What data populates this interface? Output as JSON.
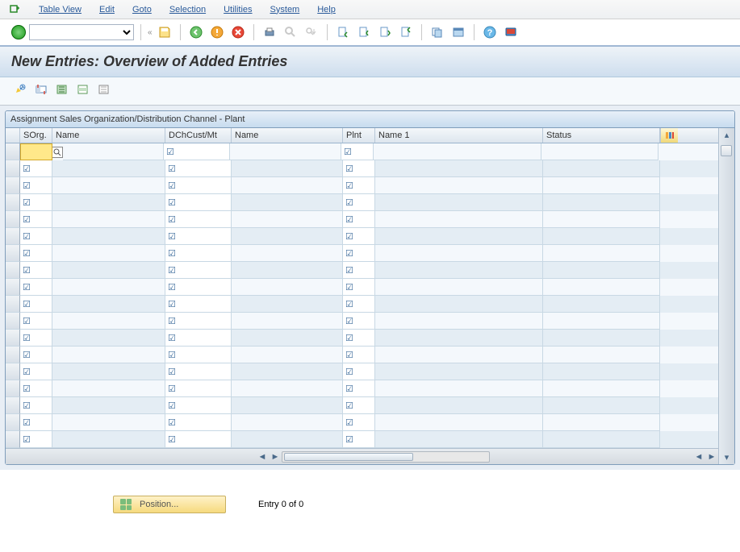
{
  "menu": {
    "items": [
      "Table View",
      "Edit",
      "Goto",
      "Selection",
      "Utilities",
      "System",
      "Help"
    ]
  },
  "toolbar_main": {
    "ok_code": "",
    "icons": [
      "back",
      "save",
      "exec-green",
      "exec-orange",
      "cancel",
      "print",
      "find",
      "find-next",
      "first-page",
      "prev-page",
      "next-page",
      "last-page",
      "new-session",
      "layout",
      "help",
      "gui-options"
    ]
  },
  "page_title": "New Entries: Overview of Added Entries",
  "toolbar_app": {
    "icons": [
      "change",
      "delimit",
      "select-all",
      "deselect-all",
      "config-col"
    ]
  },
  "panel": {
    "title": "Assignment Sales Organization/Distribution Channel - Plant",
    "columns": {
      "sorg": "SOrg.",
      "name": "Name",
      "dch": "DChCust/Mt",
      "name2": "Name",
      "plnt": "Plnt",
      "name1": "Name 1",
      "status": "Status"
    },
    "row_count": 18,
    "active_row": 0
  },
  "footer": {
    "position_label": "Position...",
    "entry_text": "Entry 0 of 0"
  }
}
